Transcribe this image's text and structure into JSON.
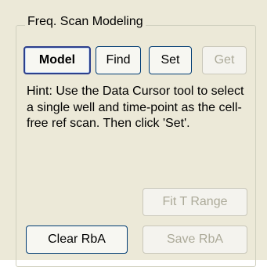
{
  "group": {
    "title": "Freq. Scan Modeling"
  },
  "buttons": {
    "model": "Model",
    "find": "Find",
    "set": "Set",
    "get": "Get",
    "fit_t_range": "Fit T Range",
    "clear_rba": "Clear RbA",
    "save_rba": "Save RbA"
  },
  "hint": "Hint: Use the Data Cursor tool to select a single well and time-point as the cell-free ref scan. Then click 'Set'."
}
